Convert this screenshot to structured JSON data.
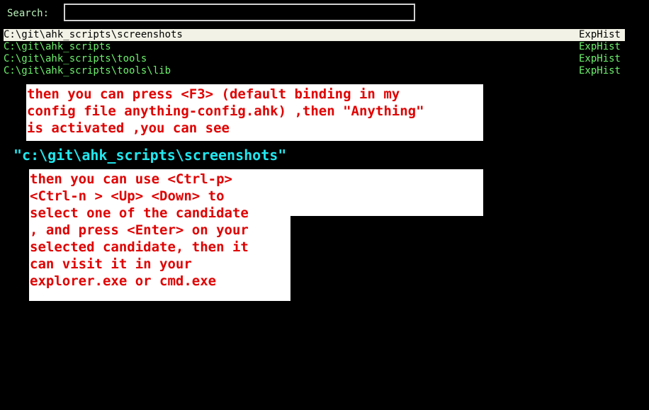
{
  "search": {
    "label": "Search:",
    "value": "",
    "placeholder": ""
  },
  "results": [
    {
      "path": "C:\\git\\ahk_scripts\\screenshots",
      "source": "ExpHist",
      "selected": true
    },
    {
      "path": "C:\\git\\ahk_scripts",
      "source": "ExpHist",
      "selected": false
    },
    {
      "path": "C:\\git\\ahk_scripts\\tools",
      "source": "ExpHist",
      "selected": false
    },
    {
      "path": "C:\\git\\ahk_scripts\\tools\\lib",
      "source": "ExpHist",
      "selected": false
    }
  ],
  "annotations": {
    "intro": "then you can press <F3> (default binding in my\nconfig file anything-config.ahk) ,then \"Anything\"\nis activated ,you can see",
    "typed_path": "\"c:\\git\\ahk_scripts\\screenshots\"",
    "usage": "then you can use <Ctrl-p>\n<Ctrl-n > <Up> <Down> to\nselect one of the candidate\n, and press <Enter> on your\nselected candidate, then it\ncan visit it in your\nexplorer.exe or cmd.exe"
  },
  "colors": {
    "background": "#000000",
    "label": "#b8f0b8",
    "result_text": "#6cf06c",
    "selected_row_bg": "#f2f2e6",
    "annotation_text": "#e00000",
    "annotation_bg": "#ffffff",
    "typed_path_text": "#20e8f0"
  }
}
